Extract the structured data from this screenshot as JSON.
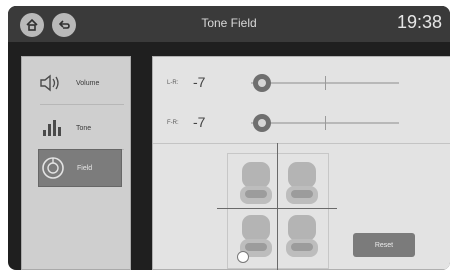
{
  "header": {
    "title": "Tone Field",
    "time": "19:38"
  },
  "sidebar": {
    "items": [
      {
        "label": "Volume"
      },
      {
        "label": "Tone"
      },
      {
        "label": "Field"
      }
    ]
  },
  "controls": {
    "lr": {
      "label": "L-R:",
      "value": "-7"
    },
    "fr": {
      "label": "F-R:",
      "value": "-7"
    }
  },
  "buttons": {
    "reset": "Reset"
  }
}
